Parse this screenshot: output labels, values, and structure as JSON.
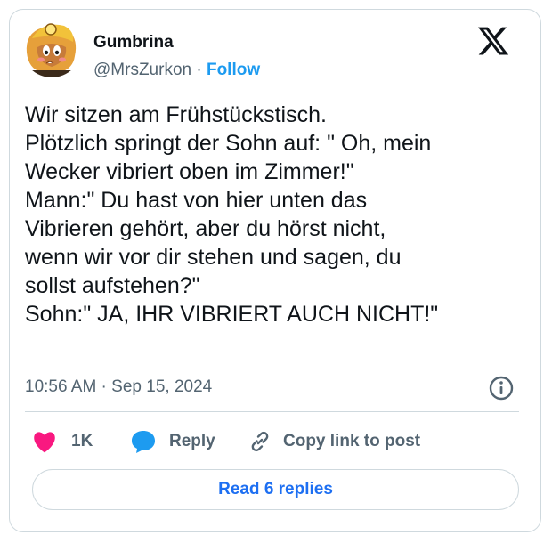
{
  "author": {
    "display_name": "Gumbrina",
    "handle": "@MrsZurkon",
    "separator": " · ",
    "follow_label": "Follow",
    "avatar_icon": "goomba-with-miner-helmet-avatar"
  },
  "platform_logo": "x-logo-icon",
  "tweet": {
    "lines": [
      "Wir sitzen am Frühstückstisch.",
      "Plötzlich springt der Sohn auf: \" Oh, mein",
      "Wecker vibriert oben im Zimmer!\"",
      "Mann:\" Du hast von hier unten das",
      "Vibrieren gehört, aber du hörst nicht,",
      "wenn wir vor dir stehen und sagen, du",
      "sollst aufstehen?\"",
      "Sohn:\" JA, IHR VIBRIERT AUCH NICHT!\""
    ],
    "timestamp": "10:56 AM · Sep 15, 2024"
  },
  "actions": {
    "likes": "1K",
    "reply_label": "Reply",
    "copy_link_label": "Copy link to post"
  },
  "read_replies_label": "Read 6 replies",
  "colors": {
    "accent": "#1d9bf0",
    "like": "#f91880",
    "secondary_text": "#536471",
    "border": "#cfd9de"
  }
}
